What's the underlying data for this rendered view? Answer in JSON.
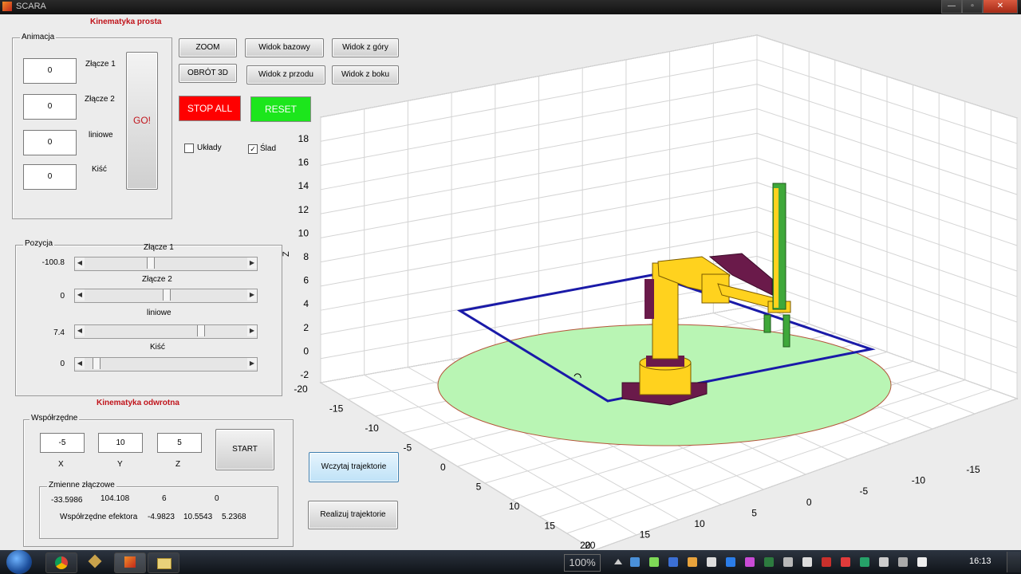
{
  "window": {
    "title": "SCARA",
    "controls": {
      "minimize": "—",
      "maximize": "▫",
      "close": "✕"
    }
  },
  "forward_kinematics": {
    "heading": "Kinematyka prosta",
    "animation": {
      "legend": "Animacja",
      "joints": [
        {
          "label": "Złącze 1",
          "value": "0"
        },
        {
          "label": "Złącze 2",
          "value": "0"
        },
        {
          "label": "liniowe",
          "value": "0"
        },
        {
          "label": "Kiść",
          "value": "0"
        }
      ],
      "go_label": "GO!"
    },
    "position": {
      "legend": "Pozycja",
      "sliders": [
        {
          "label": "Złącze 1",
          "value": "-100.8",
          "fraction": 0.4
        },
        {
          "label": "Złącze 2",
          "value": "0",
          "fraction": 0.5
        },
        {
          "label": "liniowe",
          "value": "7.4",
          "fraction": 0.72
        },
        {
          "label": "Kiść",
          "value": "0",
          "fraction": 0.05
        }
      ]
    }
  },
  "toolbar": {
    "zoom": "ZOOM",
    "rotate3d": "OBRÓT 3D",
    "view_base": "Widok bazowy",
    "view_top": "Widok z góry",
    "view_front": "Widok z przodu",
    "view_side": "Widok z boku",
    "stop_all": "STOP ALL",
    "reset": "RESET",
    "frames_checkbox": {
      "label": "Układy",
      "checked": false
    },
    "trace_checkbox": {
      "label": "Ślad",
      "checked": true
    }
  },
  "inverse_kinematics": {
    "heading": "Kinematyka odwrotna",
    "coords": {
      "legend": "Współrzędne",
      "x": {
        "label": "X",
        "value": "-5"
      },
      "y": {
        "label": "Y",
        "value": "10"
      },
      "z": {
        "label": "Z",
        "value": "5"
      },
      "start": "START"
    },
    "joint_vars": {
      "legend": "Zmienne złączowe",
      "values": [
        "-33.5986",
        "104.108",
        "6",
        "0"
      ],
      "effector_label": "Współrzędne efektora",
      "effector_values": [
        "-4.9823",
        "10.5543",
        "5.2368"
      ]
    }
  },
  "trajectory": {
    "load": "Wczytaj trajektorie",
    "execute": "Realizuj trajektorie"
  },
  "plot": {
    "z_label": "Z",
    "z_ticks": [
      "18",
      "16",
      "14",
      "12",
      "10",
      "8",
      "6",
      "4",
      "2",
      "0",
      "-2"
    ],
    "left_axis_ticks": [
      "-20",
      "-15",
      "-10",
      "-5",
      "0",
      "5",
      "10",
      "15",
      "20"
    ],
    "right_axis_ticks": [
      "-15",
      "-10",
      "-5",
      "0",
      "5",
      "10",
      "15",
      "20"
    ],
    "colors": {
      "disk": "#b9f5b4",
      "path": "#1a1aa8",
      "arm": "#ffd21e",
      "base": "#6a1a4a"
    }
  },
  "taskbar": {
    "zoom_level": "100%",
    "clock": "16:13",
    "start_icon": "windows-orb-icon"
  }
}
